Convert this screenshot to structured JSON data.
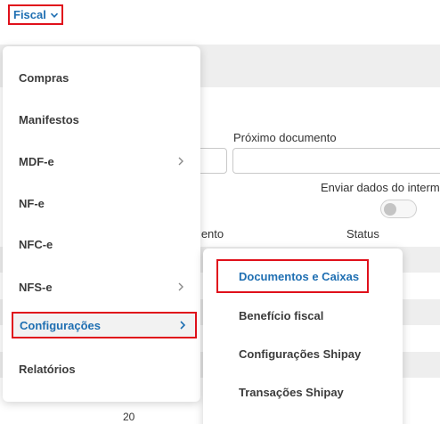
{
  "topbar": {
    "menu_label": "Fiscal",
    "icon": "chevron-down-icon"
  },
  "background": {
    "field_label": "Próximo documento",
    "toggle_label": "Enviar dados do interme",
    "toggle_on": false,
    "columns": [
      "mento",
      "Status"
    ],
    "footer_value": "20"
  },
  "menu": {
    "items": [
      {
        "label": "Compras",
        "has_submenu": false
      },
      {
        "label": "Manifestos",
        "has_submenu": false
      },
      {
        "label": "MDF-e",
        "has_submenu": true
      },
      {
        "label": "NF-e",
        "has_submenu": false
      },
      {
        "label": "NFC-e",
        "has_submenu": false
      },
      {
        "label": "NFS-e",
        "has_submenu": true
      },
      {
        "label": "Configurações",
        "has_submenu": true,
        "selected": true
      },
      {
        "label": "Relatórios",
        "has_submenu": false
      }
    ]
  },
  "submenu": {
    "items": [
      {
        "label": "Documentos e Caixas",
        "selected": true
      },
      {
        "label": "Benefício fiscal"
      },
      {
        "label": "Configurações Shipay"
      },
      {
        "label": "Transações Shipay"
      }
    ]
  },
  "colors": {
    "accent": "#1f6fb2",
    "highlight_border": "#e0101b",
    "text": "#3c3c3c",
    "page_bg": "#eeeeee"
  }
}
